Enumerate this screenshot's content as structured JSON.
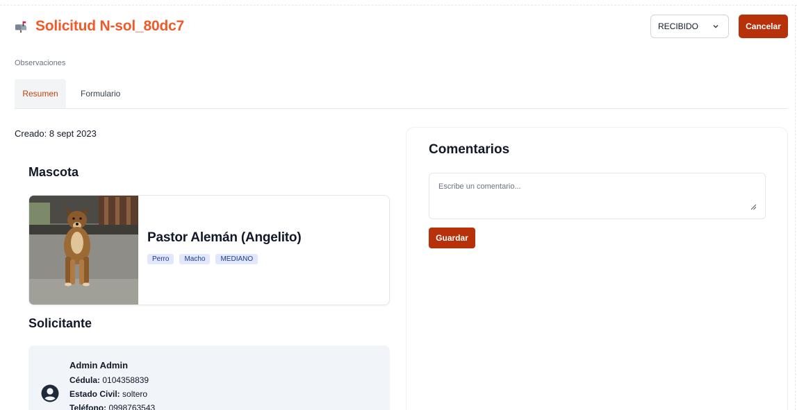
{
  "header": {
    "title": "Solicitud N-sol_80dc7",
    "icon": "mailbox-icon",
    "status_value": "RECIBIDO",
    "cancel_label": "Cancelar"
  },
  "observaciones_label": "Observaciones",
  "tabs": [
    {
      "label": "Resumen",
      "active": true
    },
    {
      "label": "Formulario",
      "active": false
    }
  ],
  "created": "Creado: 8 sept 2023",
  "mascota": {
    "section_title": "Mascota",
    "name": "Pastor Alemán (Angelito)",
    "tags": [
      "Perro",
      "Macho",
      "MEDIANO"
    ]
  },
  "solicitante": {
    "section_title": "Solicitante",
    "name": "Admin Admin",
    "cedula_label": "Cédula:",
    "cedula_value": "0104358839",
    "estado_civil_label": "Estado Civil:",
    "estado_civil_value": "soltero",
    "telefono_label": "Teléfono:",
    "telefono_value": "0998763543"
  },
  "comentarios": {
    "title": "Comentarios",
    "placeholder": "Escribe un comentario...",
    "save_label": "Guardar"
  },
  "colors": {
    "title_orange": "#f05a28",
    "button_red": "#b7310b",
    "tag_bg": "#e0e7ff",
    "tag_text": "#1e3a8a"
  }
}
